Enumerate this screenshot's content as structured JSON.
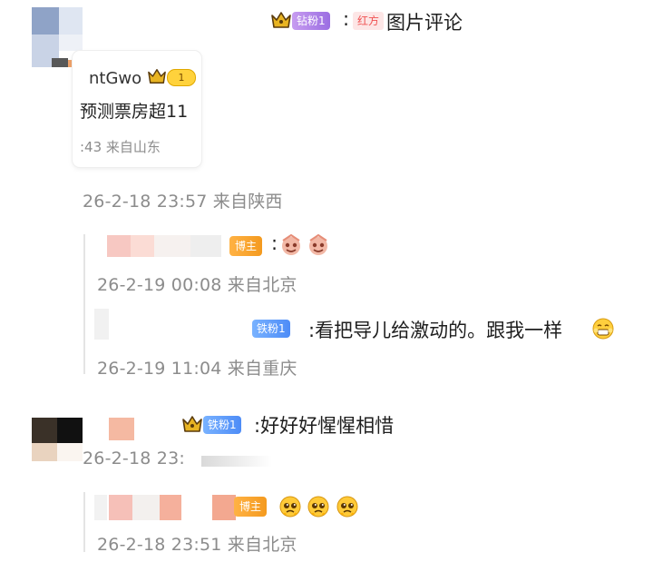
{
  "comment1": {
    "badge_fans": "钻粉1",
    "badge_team": "红方",
    "text": "图片评论",
    "quote_card": {
      "username": "ntGwo",
      "level": "1",
      "text": "预测票房超11",
      "meta": ":43  来自山东"
    },
    "meta": "26-2-18 23:57 来自陕西"
  },
  "reply1": {
    "badge": "博主",
    "meta": "26-2-19 00:08 来自北京"
  },
  "reply2": {
    "badge": "铁粉1",
    "text": ":看把导儿给激动的。跟我一样",
    "meta": "26-2-19 11:04 来自重庆"
  },
  "comment2": {
    "badge": "铁粉1",
    "text": ":好好好惺惺相惜",
    "meta": "26-2-18 23:"
  },
  "reply3": {
    "badge": "博主",
    "meta": "26-2-18 23:51 来自北京"
  },
  "colon": ":",
  "colors": {
    "meta_gray": "#8c8c8c",
    "badge_purple": "#b084ea",
    "badge_orange": "#f5a128",
    "badge_blue": "#5f9cf9",
    "team_red": "#f05252"
  },
  "icons": [
    "crown-icon",
    "star-eyes-emoji-icon",
    "grin-emoji-icon",
    "pleading-emoji-icon"
  ]
}
